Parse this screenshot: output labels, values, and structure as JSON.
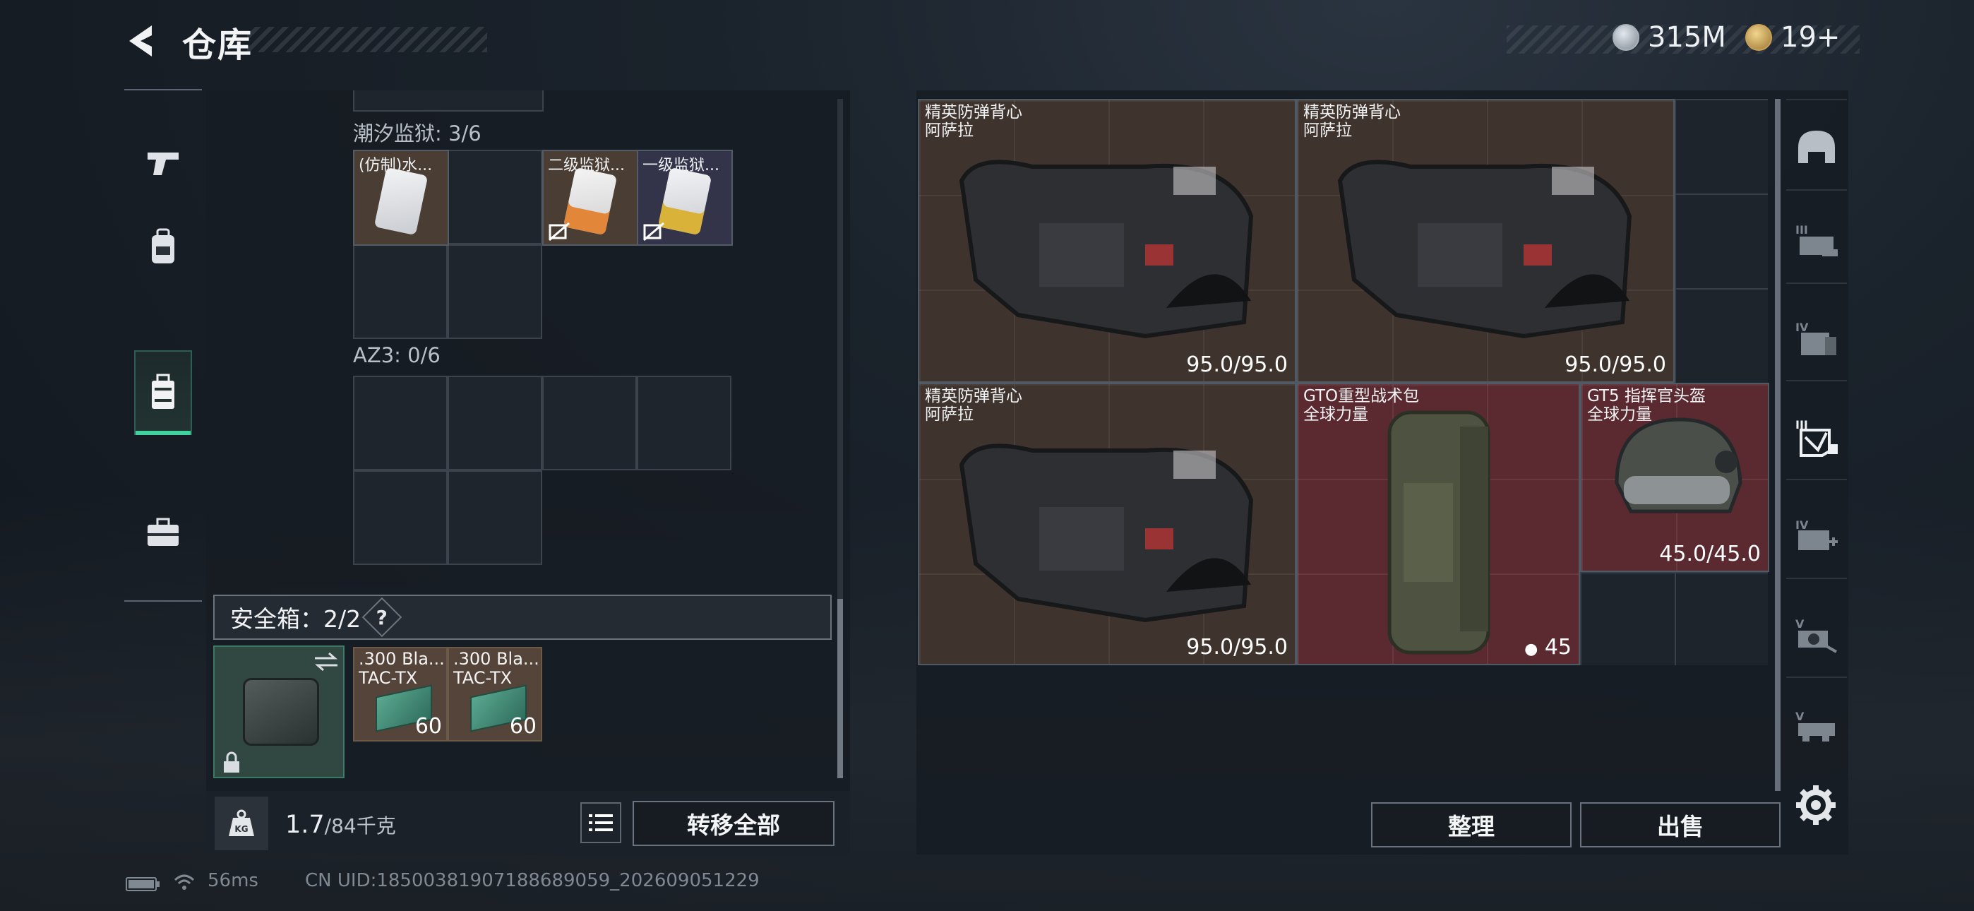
{
  "header": {
    "title": "仓库",
    "currency1_value": "315M",
    "currency2_value": "19+",
    "colors": {
      "currency1": "#b9c2cc",
      "currency2": "#c7a25a"
    }
  },
  "left_tabs": [
    {
      "name": "weapons",
      "icon": "pistol-icon",
      "active": false
    },
    {
      "name": "gear",
      "icon": "backpack-icon",
      "active": false
    },
    {
      "name": "containers",
      "icon": "case-icon",
      "active": true
    },
    {
      "name": "medical",
      "icon": "toolbox-icon",
      "active": false
    }
  ],
  "sections": {
    "tide_prison": {
      "label": "潮汐监狱: 3/6",
      "items": [
        {
          "name": "(仿制)水..."
        },
        {
          "name": "二级监狱..."
        },
        {
          "name": "一级监狱..."
        }
      ]
    },
    "az3": {
      "label": "AZ3: 0/6"
    }
  },
  "safe": {
    "label": "安全箱：2/2",
    "help": "?",
    "items": [
      {
        "name": ".300 Bla...",
        "sub": "TAC-TX",
        "count": "60"
      },
      {
        "name": ".300 Bla...",
        "sub": "TAC-TX",
        "count": "60"
      }
    ]
  },
  "weight": {
    "current": "1.7",
    "max": "/84千克"
  },
  "buttons": {
    "transfer_all": "转移全部",
    "sort": "整理",
    "sell": "出售"
  },
  "stash_items": [
    {
      "name": "精英防弹背心",
      "brand": "阿萨拉",
      "durability": "95.0/95.0"
    },
    {
      "name": "精英防弹背心",
      "brand": "阿萨拉",
      "durability": "95.0/95.0"
    },
    {
      "name": "精英防弹背心",
      "brand": "阿萨拉",
      "durability": "95.0/95.0"
    },
    {
      "name": "GTO重型战术包",
      "brand": "全球力量",
      "capacity": "45"
    },
    {
      "name": "GT5 指挥官头盔",
      "brand": "全球力量",
      "durability": "45.0/45.0"
    }
  ],
  "right_tabs": [
    {
      "icon": "helmet-icon"
    },
    {
      "icon": "armor-III-icon",
      "tier": "III"
    },
    {
      "icon": "folder-IV-icon",
      "tier": "IV"
    },
    {
      "icon": "armor-active-icon",
      "tier": "III",
      "active": true
    },
    {
      "icon": "medkit-IV-icon",
      "tier": "IV"
    },
    {
      "icon": "scope-V-icon",
      "tier": "V"
    },
    {
      "icon": "rig-V-icon",
      "tier": "V"
    }
  ],
  "footer": {
    "ping": "56ms",
    "uid": "CN UID:18500381907188689059_202609051229"
  }
}
